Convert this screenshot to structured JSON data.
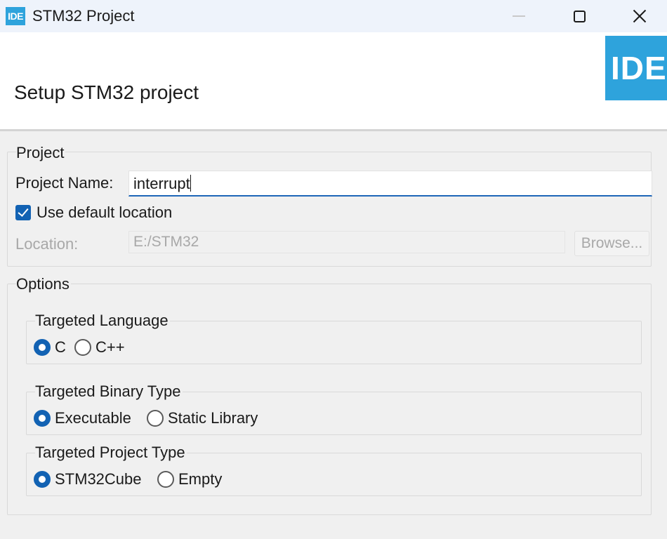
{
  "window": {
    "title": "STM32 Project",
    "app_icon_text": "IDE"
  },
  "banner": {
    "title": "Setup STM32 project",
    "logo_text": "IDE"
  },
  "project": {
    "group_title": "Project",
    "name_label": "Project Name:",
    "name_value": "interrupt",
    "use_default_label": "Use default location",
    "use_default_checked": true,
    "location_label": "Location:",
    "location_value": "E:/STM32",
    "browse_label": "Browse..."
  },
  "options": {
    "group_title": "Options",
    "language": {
      "title": "Targeted Language",
      "choices": [
        "C",
        "C++"
      ],
      "selected": "C"
    },
    "binary_type": {
      "title": "Targeted Binary Type",
      "choices": [
        "Executable",
        "Static Library"
      ],
      "selected": "Executable"
    },
    "project_type": {
      "title": "Targeted Project Type",
      "choices": [
        "STM32Cube",
        "Empty"
      ],
      "selected": "STM32Cube"
    }
  },
  "colors": {
    "accent": "#1262b3",
    "logo": "#2ea3dc"
  }
}
